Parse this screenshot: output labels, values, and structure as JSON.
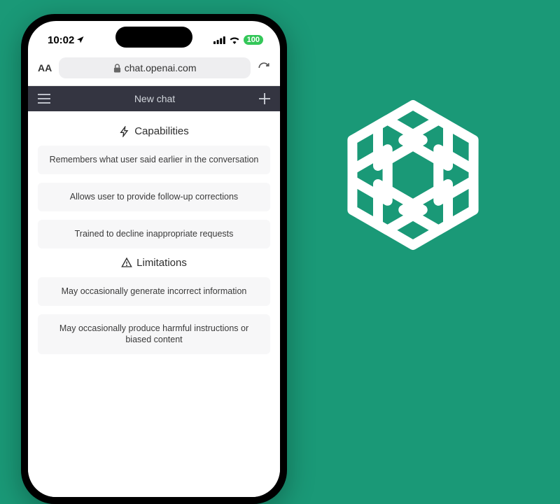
{
  "status": {
    "time": "10:02",
    "battery": "100"
  },
  "browser": {
    "aa": "AA",
    "url": "chat.openai.com"
  },
  "header": {
    "title": "New chat"
  },
  "sections": [
    {
      "title": "Capabilities",
      "items": [
        "Remembers what user said earlier in the conversation",
        "Allows user to provide follow-up corrections",
        "Trained to decline inappropriate requests"
      ]
    },
    {
      "title": "Limitations",
      "items": [
        "May occasionally generate incorrect information",
        "May occasionally produce harmful instructions or biased content"
      ]
    }
  ]
}
